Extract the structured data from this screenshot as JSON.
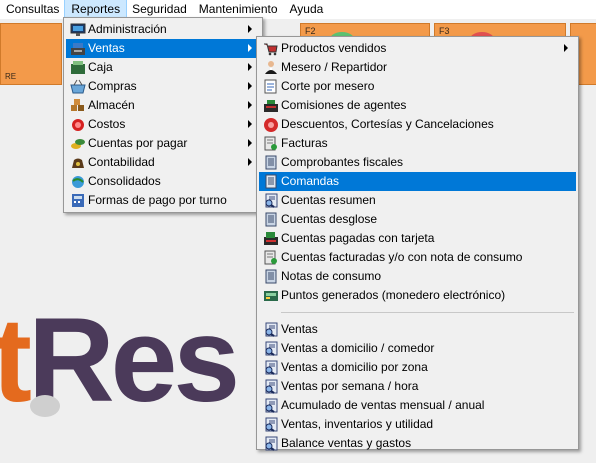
{
  "menubar": {
    "items": [
      "Consultas",
      "Reportes",
      "Seguridad",
      "Mantenimiento",
      "Ayuda"
    ]
  },
  "toolbar": {
    "f2": "F2",
    "f3": "F3",
    "left_label": "RE"
  },
  "watermark": {
    "prefix": "t",
    "text": "Res"
  },
  "reportes_menu": {
    "items": [
      {
        "label": "Administración",
        "icon": "monitor-icon",
        "submenu": true
      },
      {
        "label": "Ventas",
        "icon": "register-icon",
        "submenu": true,
        "highlighted": true
      },
      {
        "label": "Caja",
        "icon": "cashbox-icon",
        "submenu": true
      },
      {
        "label": "Compras",
        "icon": "basket-icon",
        "submenu": true
      },
      {
        "label": "Almacén",
        "icon": "boxes-icon",
        "submenu": true
      },
      {
        "label": "Costos",
        "icon": "costs-icon",
        "submenu": true
      },
      {
        "label": "Cuentas por pagar",
        "icon": "coins-icon",
        "submenu": true
      },
      {
        "label": "Contabilidad",
        "icon": "money-bag-icon",
        "submenu": true
      },
      {
        "label": "Consolidados",
        "icon": "globe-icon",
        "submenu": false
      },
      {
        "label": "Formas de pago por turno",
        "icon": "calculator-icon",
        "submenu": false
      }
    ]
  },
  "ventas_menu": {
    "group1": [
      {
        "label": "Productos vendidos",
        "icon": "cart-icon",
        "submenu": true
      },
      {
        "label": "Mesero / Repartidor",
        "icon": "waiter-icon"
      },
      {
        "label": "Corte por mesero",
        "icon": "report-icon"
      },
      {
        "label": "Comisiones de agentes",
        "icon": "cash-register-icon"
      },
      {
        "label": "Descuentos, Cortesías y Cancelaciones",
        "icon": "discount-icon"
      },
      {
        "label": "Facturas",
        "icon": "invoice-icon"
      },
      {
        "label": "Comprobantes fiscales",
        "icon": "document-icon"
      },
      {
        "label": "Comandas",
        "icon": "order-ticket-icon",
        "highlighted": true
      },
      {
        "label": "Cuentas resumen",
        "icon": "magnifier-report-icon"
      },
      {
        "label": "Cuentas desglose",
        "icon": "document-icon"
      },
      {
        "label": "Cuentas pagadas con tarjeta",
        "icon": "card-register-icon"
      },
      {
        "label": "Cuentas facturadas y/o con nota de consumo",
        "icon": "invoice-icon"
      },
      {
        "label": "Notas de consumo",
        "icon": "document-icon"
      },
      {
        "label": "Puntos generados (monedero electrónico)",
        "icon": "points-icon"
      }
    ],
    "group2": [
      {
        "label": "Ventas",
        "icon": "magnifier-report-icon"
      },
      {
        "label": "Ventas a domicilio / comedor",
        "icon": "magnifier-report-icon"
      },
      {
        "label": "Ventas a domicilio por zona",
        "icon": "magnifier-report-icon"
      },
      {
        "label": "Ventas por semana / hora",
        "icon": "magnifier-report-icon"
      },
      {
        "label": "Acumulado de ventas mensual / anual",
        "icon": "magnifier-report-icon"
      },
      {
        "label": "Ventas, inventarios y utilidad",
        "icon": "magnifier-report-icon"
      },
      {
        "label": "Balance ventas y gastos",
        "icon": "magnifier-report-icon"
      }
    ]
  },
  "colors": {
    "highlight": "#0078d7",
    "toolbar_orange": "#f39a4a",
    "menu_bg": "#f0f0f0"
  }
}
